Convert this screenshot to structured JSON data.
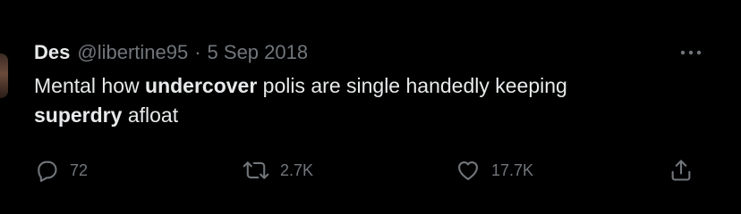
{
  "tweet": {
    "author_name": "Des",
    "handle": "@libertine95",
    "separator": "·",
    "date": "5 Sep 2018",
    "text": {
      "t1": "Mental how ",
      "b1": "undercover",
      "t2": " polis are single handedly keeping",
      "b2": "superdry",
      "t3": " afloat"
    }
  },
  "actions": {
    "reply": {
      "icon": "reply-icon",
      "count": "72"
    },
    "retweet": {
      "icon": "retweet-icon",
      "count": "2.7K"
    },
    "like": {
      "icon": "heart-icon",
      "count": "17.7K"
    },
    "share": {
      "icon": "share-icon"
    }
  },
  "colors": {
    "background": "#000000",
    "primary_text": "#e7e9ea",
    "secondary_text": "#71767b"
  }
}
